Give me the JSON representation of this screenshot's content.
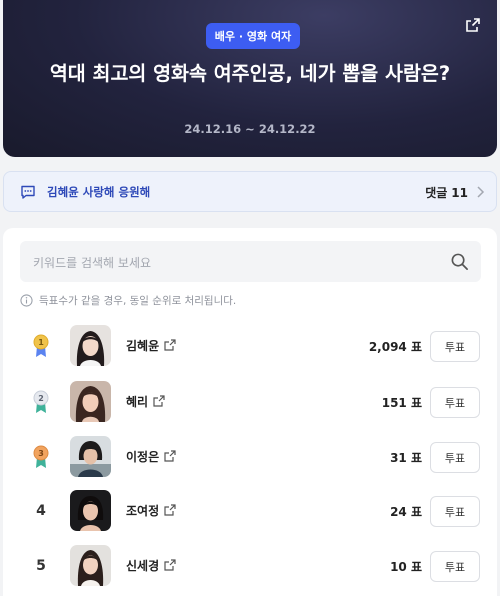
{
  "header": {
    "category": "배우 · 영화 여자",
    "title": "역대 최고의 영화속 여주인공, 네가 뽑을 사람은?",
    "dates": "24.12.16 ~ 24.12.22",
    "share_icon": "share-icon"
  },
  "cheer": {
    "text": "김혜윤 사랑해 응원해",
    "comments_label": "댓글",
    "comments_count": "11"
  },
  "search": {
    "placeholder": "키워드를 검색해 보세요"
  },
  "notice": "득표수가 같을 경우, 동일 순위로 처리됩니다.",
  "vote_label": "투표",
  "colors": {
    "accent": "#3d5df2",
    "gold": "#f0c34a",
    "silver": "#c7cdd8",
    "bronze": "#f1a35e",
    "medal_ribbon": "#5b83f0"
  },
  "candidates": [
    {
      "rank": "1",
      "name": "김혜윤",
      "votes": "2,094 표"
    },
    {
      "rank": "2",
      "name": "혜리",
      "votes": "151 표"
    },
    {
      "rank": "3",
      "name": "이정은",
      "votes": "31 표"
    },
    {
      "rank": "4",
      "name": "조여정",
      "votes": "24 표"
    },
    {
      "rank": "5",
      "name": "신세경",
      "votes": "10 표"
    }
  ]
}
